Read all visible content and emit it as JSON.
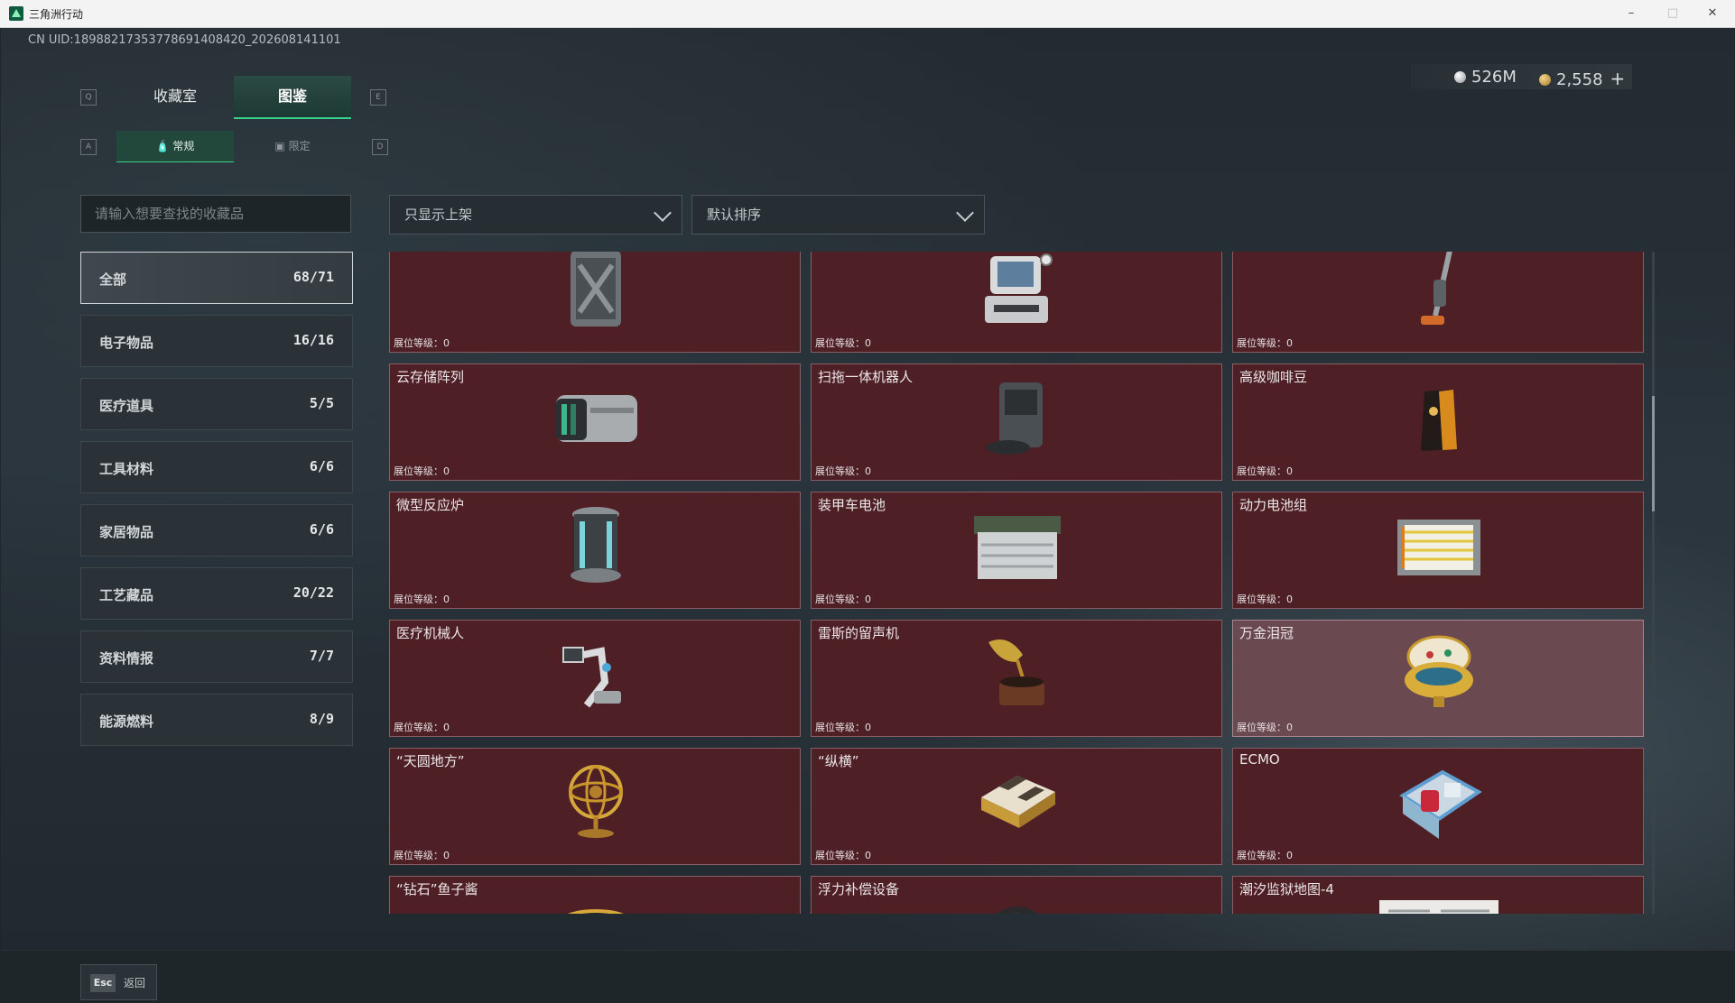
{
  "window": {
    "title": "三角洲行动",
    "min": "–",
    "max": "□",
    "close": "✕"
  },
  "uid": "CN UID:18988217353778691408420_202608141101",
  "currency": {
    "silver": "526M",
    "gold": "2,558",
    "add": "+"
  },
  "tabs": {
    "left_key": "Q",
    "right_key": "E",
    "items": [
      {
        "label": "收藏室"
      },
      {
        "label": "图鉴"
      }
    ]
  },
  "subtabs": {
    "left_key": "A",
    "right_key": "D",
    "items": [
      {
        "label": "常规"
      },
      {
        "label": "限定"
      }
    ]
  },
  "search": {
    "placeholder": "请输入想要查找的收藏品"
  },
  "filters": {
    "shelf": "只显示上架",
    "sort": "默认排序"
  },
  "categories": [
    {
      "name": "全部",
      "count": "68/71"
    },
    {
      "name": "电子物品",
      "count": "16/16"
    },
    {
      "name": "医疗道具",
      "count": "5/5"
    },
    {
      "name": "工具材料",
      "count": "6/6"
    },
    {
      "name": "家居物品",
      "count": "6/6"
    },
    {
      "name": "工艺藏品",
      "count": "20/22"
    },
    {
      "name": "资料情报",
      "count": "7/7"
    },
    {
      "name": "能源燃料",
      "count": "8/9"
    }
  ],
  "items": [
    {
      "name": "",
      "level": "展位等级：0",
      "icon": "fuel-can-icon"
    },
    {
      "name": "",
      "level": "展位等级：0",
      "icon": "monitor-device-icon"
    },
    {
      "name": "",
      "level": "展位等级：0",
      "icon": "vacuum-icon"
    },
    {
      "name": "云存储阵列",
      "level": "展位等级：0",
      "icon": "server-array-icon"
    },
    {
      "name": "扫拖一体机器人",
      "level": "展位等级：0",
      "icon": "robot-vacuum-icon"
    },
    {
      "name": "高级咖啡豆",
      "level": "展位等级：0",
      "icon": "coffee-bag-icon"
    },
    {
      "name": "微型反应炉",
      "level": "展位等级：0",
      "icon": "reactor-icon"
    },
    {
      "name": "装甲车电池",
      "level": "展位等级：0",
      "icon": "battery-icon"
    },
    {
      "name": "动力电池组",
      "level": "展位等级：0",
      "icon": "battery-pack-icon"
    },
    {
      "name": "医疗机械人",
      "level": "展位等级：0",
      "icon": "medical-robot-icon"
    },
    {
      "name": "雷斯的留声机",
      "level": "展位等级：0",
      "icon": "gramophone-icon"
    },
    {
      "name": "万金泪冠",
      "level": "展位等级：0",
      "icon": "jeweled-egg-icon"
    },
    {
      "name": "“天圆地方”",
      "level": "展位等级：0",
      "icon": "armillary-sphere-icon"
    },
    {
      "name": "“纵横”",
      "level": "展位等级：0",
      "icon": "chessboard-icon"
    },
    {
      "name": "ECMO",
      "level": "展位等级：0",
      "icon": "ecmo-machine-icon"
    },
    {
      "name": "“钻石”鱼子酱",
      "level": "",
      "icon": "caviar-tin-icon"
    },
    {
      "name": "浮力补偿设备",
      "level": "",
      "icon": "buoyancy-device-icon"
    },
    {
      "name": "潮汐监狱地图-4",
      "level": "",
      "icon": "map-document-icon"
    }
  ],
  "footer": {
    "key": "Esc",
    "label": "返回"
  },
  "colors": {
    "accent": "#38d38f",
    "card_bg": "#4e2026",
    "card_highlight": "#6a4a50"
  }
}
